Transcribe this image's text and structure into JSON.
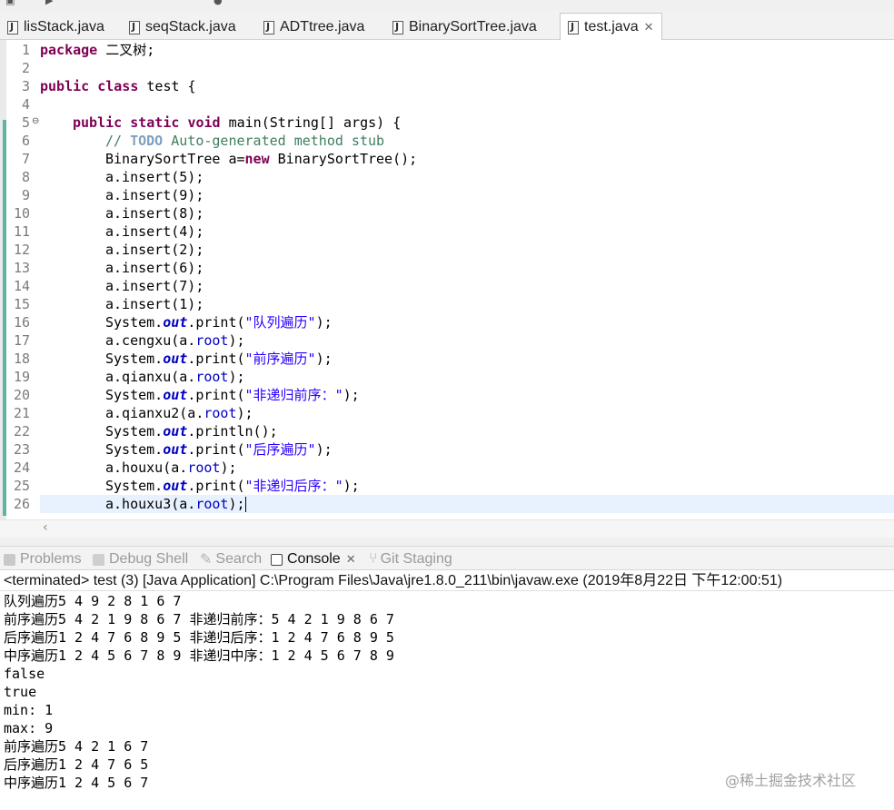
{
  "editor_tabs": [
    {
      "label": "lisStack.java",
      "active": false
    },
    {
      "label": "seqStack.java",
      "active": false
    },
    {
      "label": "ADTtree.java",
      "active": false
    },
    {
      "label": "BinarySortTree.java",
      "active": false
    },
    {
      "label": "test.java",
      "active": true
    }
  ],
  "line_numbers": [
    "1",
    "2",
    "3",
    "4",
    "5",
    "6",
    "7",
    "8",
    "9",
    "10",
    "11",
    "12",
    "13",
    "14",
    "15",
    "16",
    "17",
    "18",
    "19",
    "20",
    "21",
    "22",
    "23",
    "24",
    "25",
    "26"
  ],
  "code": {
    "l1_kw": "package",
    "l1_rest": " 二叉树;",
    "l3_kw1": "public",
    "l3_kw2": "class",
    "l3_rest": " test {",
    "l5_kw1": "public",
    "l5_kw2": "static",
    "l5_kw3": "void",
    "l5_rest": " main(String[] args) {",
    "l6_c1": "// ",
    "l6_todo": "TODO",
    "l6_c2": " Auto-generated method stub",
    "l7_a": "BinarySortTree a=",
    "l7_kw": "new",
    "l7_b": " BinarySortTree();",
    "l8": "a.insert(5);",
    "l9": "a.insert(9);",
    "l10": "a.insert(8);",
    "l11": "a.insert(4);",
    "l12": "a.insert(2);",
    "l13": "a.insert(6);",
    "l14": "a.insert(7);",
    "l15": "a.insert(1);",
    "l16_a": "System.",
    "l16_out": "out",
    "l16_b": ".print(",
    "l16_s": "\"队列遍历\"",
    "l16_c": ");",
    "l17_a": "a.cengxu(a.",
    "l17_f": "root",
    "l17_b": ");",
    "l18_a": "System.",
    "l18_out": "out",
    "l18_b": ".print(",
    "l18_s": "\"前序遍历\"",
    "l18_c": ");",
    "l19_a": "a.qianxu(a.",
    "l19_f": "root",
    "l19_b": ");",
    "l20_a": "System.",
    "l20_out": "out",
    "l20_b": ".print(",
    "l20_s": "\"非递归前序：\"",
    "l20_c": ");",
    "l21_a": "a.qianxu2(a.",
    "l21_f": "root",
    "l21_b": ");",
    "l22_a": "System.",
    "l22_out": "out",
    "l22_b": ".println();",
    "l23_a": "System.",
    "l23_out": "out",
    "l23_b": ".print(",
    "l23_s": "\"后序遍历\"",
    "l23_c": ");",
    "l24_a": "a.houxu(a.",
    "l24_f": "root",
    "l24_b": ");",
    "l25_a": "System.",
    "l25_out": "out",
    "l25_b": ".print(",
    "l25_s": "\"非递归后序：\"",
    "l25_c": ");",
    "l26_a": "a.houxu3(a.",
    "l26_f": "root",
    "l26_b": ");"
  },
  "panel_tabs": [
    {
      "label": "Problems",
      "active": false
    },
    {
      "label": "Debug Shell",
      "active": false
    },
    {
      "label": "Search",
      "active": false
    },
    {
      "label": "Console",
      "active": true
    },
    {
      "label": "Git Staging",
      "active": false
    }
  ],
  "console_status": "<terminated> test (3) [Java Application] C:\\Program Files\\Java\\jre1.8.0_211\\bin\\javaw.exe (2019年8月22日 下午12:00:51)",
  "console_lines": [
    "队列遍历5 4 9 2 8 1 6 7",
    "前序遍历5 4 2 1 9 8 6 7 非递归前序：5 4 2 1 9 8 6 7",
    "后序遍历1 2 4 7 6 8 9 5 非递归后序：1 2 4 7 6 8 9 5",
    "中序遍历1 2 4 5 6 7 8 9 非递归中序：1 2 4 5 6 7 8 9",
    "false",
    "true",
    "min: 1",
    "max: 9",
    "前序遍历5 4 2 1 6 7",
    "后序遍历1 2 4 7 6 5",
    "中序遍历1 2 4 5 6 7"
  ],
  "watermark": "@稀土掘金技术社区",
  "colors": {
    "keyword": "#7f0055",
    "comment": "#3f7f5f",
    "string": "#2a00ff",
    "field": "#0000c0",
    "current_line": "#e8f2fe"
  }
}
